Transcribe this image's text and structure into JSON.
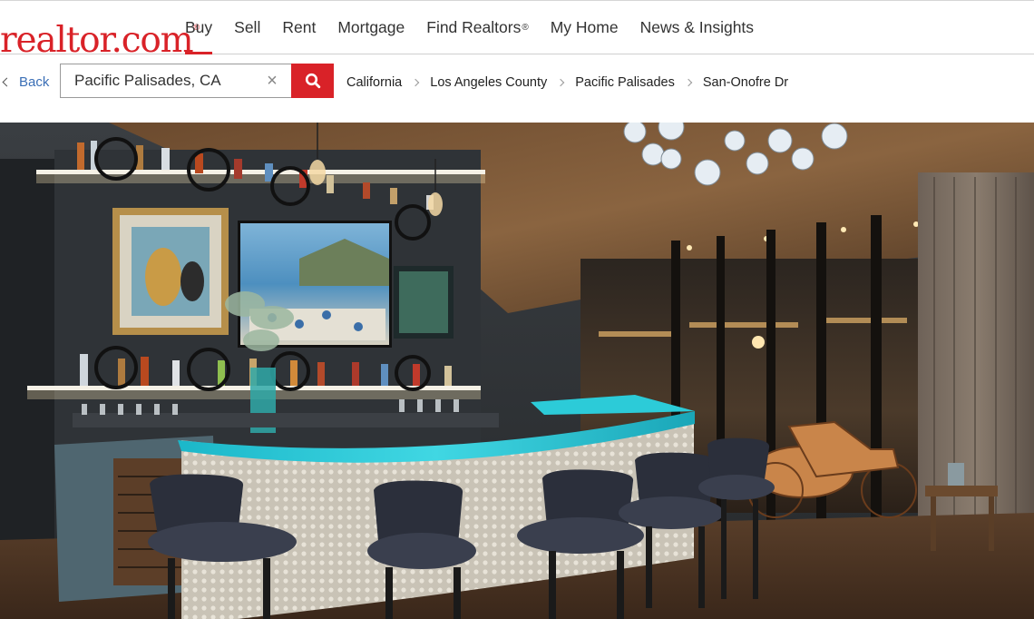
{
  "brand": {
    "logo_text": "realtor.com",
    "logo_mark": "®",
    "color": "#d92228"
  },
  "nav": {
    "items": [
      {
        "label": "Buy",
        "active": true
      },
      {
        "label": "Sell"
      },
      {
        "label": "Rent"
      },
      {
        "label": "Mortgage"
      },
      {
        "label": "Find Realtors",
        "mark": "®"
      },
      {
        "label": "My Home"
      },
      {
        "label": "News & Insights"
      }
    ]
  },
  "subbar": {
    "back_label": "Back",
    "search": {
      "value": "Pacific Palisades, CA",
      "clear_icon": "close-icon",
      "submit_icon": "search-icon"
    },
    "breadcrumb": [
      "California",
      "Los Angeles County",
      "Pacific Palisades",
      "San-Onofre Dr"
    ]
  },
  "photo": {
    "subject": "home-bar-interior"
  }
}
